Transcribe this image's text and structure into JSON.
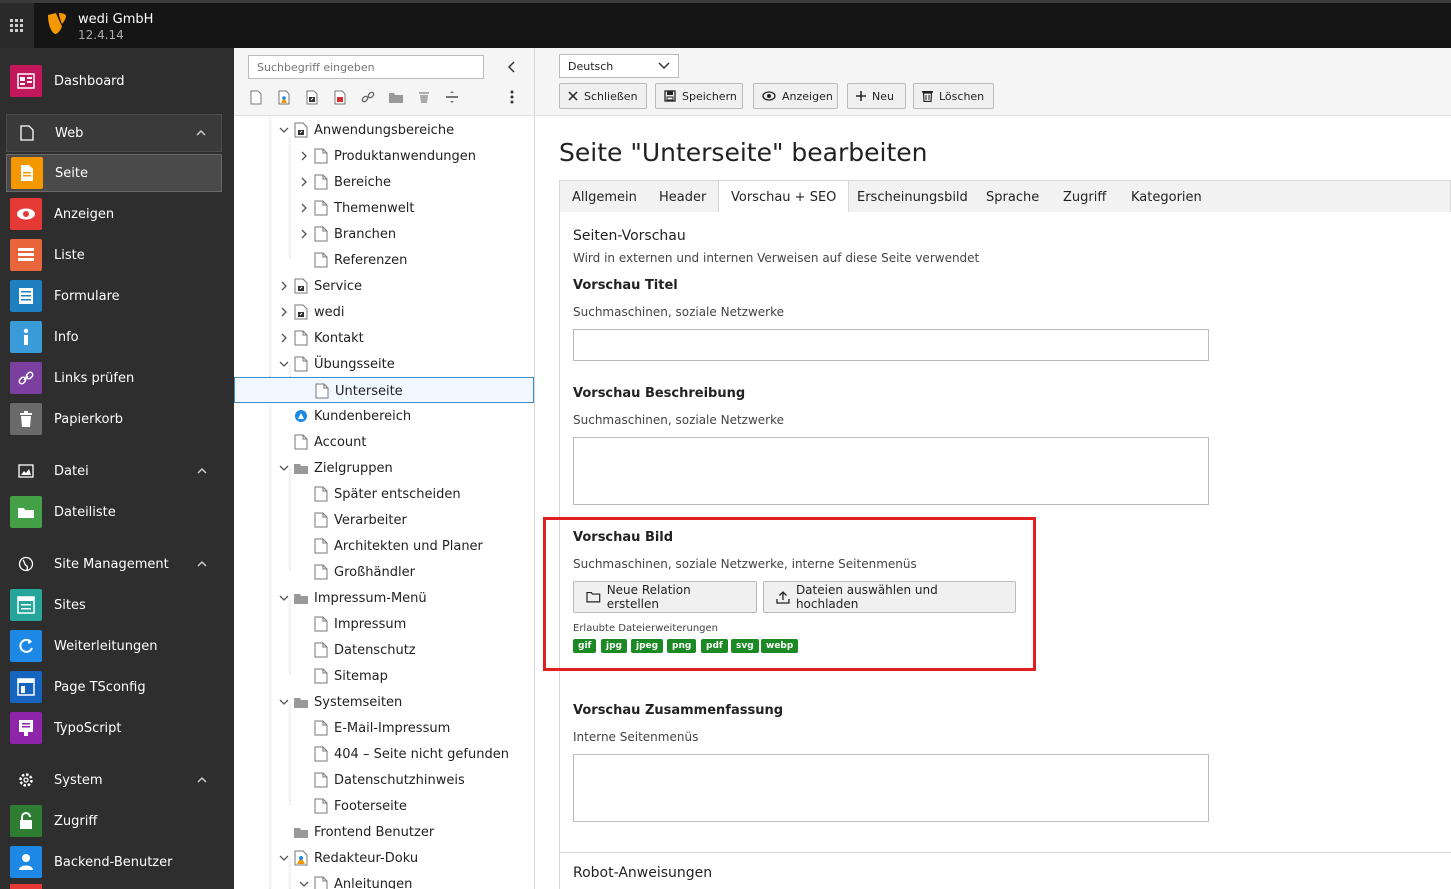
{
  "topbar": {
    "site_name": "wedi GmbH",
    "version": "12.4.14"
  },
  "modulemenu": {
    "dashboard": "Dashboard",
    "web_group": "Web",
    "seite": "Seite",
    "anzeigen": "Anzeigen",
    "liste": "Liste",
    "formulare": "Formulare",
    "info": "Info",
    "links_pruefen": "Links prüfen",
    "papierkorb": "Papierkorb",
    "datei_group": "Datei",
    "dateiliste": "Dateiliste",
    "site_management_group": "Site Management",
    "sites": "Sites",
    "weiterleitungen": "Weiterleitungen",
    "page_tsconfig": "Page TSconfig",
    "typoscript": "TypoScript",
    "system_group": "System",
    "zugriff": "Zugriff",
    "backend_benutzer": "Backend-Benutzer"
  },
  "pagetree": {
    "search_placeholder": "Suchbegriff eingeben",
    "nodes": [
      "Anwendungsbereiche",
      "Produktanwendungen",
      "Bereiche",
      "Themenwelt",
      "Branchen",
      "Referenzen",
      "Service",
      "wedi",
      "Kontakt",
      "Übungsseite",
      "Unterseite",
      "Kundenbereich",
      "Account",
      "Zielgruppen",
      "Später entscheiden",
      "Verarbeiter",
      "Architekten und Planer",
      "Großhändler",
      "Impressum-Menü",
      "Impressum",
      "Datenschutz",
      "Sitemap",
      "Systemseiten",
      "E-Mail-Impressum",
      "404 – Seite nicht gefunden",
      "Datenschutzhinweis",
      "Footerseite",
      "Frontend Benutzer",
      "Redakteur-Doku",
      "Anleitungen"
    ]
  },
  "docheader": {
    "language": "Deutsch",
    "buttons": {
      "close": "Schließen",
      "save": "Speichern",
      "view": "Anzeigen",
      "new": "Neu",
      "delete": "Löschen"
    }
  },
  "editor": {
    "title": "Seite \"Unterseite\" bearbeiten",
    "tabs": [
      "Allgemein",
      "Header",
      "Vorschau + SEO",
      "Erscheinungsbild",
      "Sprache",
      "Zugriff",
      "Kategorien"
    ],
    "active_tab": "Vorschau + SEO",
    "section_title": "Seiten-Vorschau",
    "section_help": "Wird in externen und internen Verweisen auf diese Seite verwendet",
    "fields": {
      "og_title_label": "Vorschau Titel",
      "og_title_desc": "Suchmaschinen, soziale Netzwerke",
      "og_title_value": "",
      "description_label": "Vorschau Beschreibung",
      "description_desc": "Suchmaschinen, soziale Netzwerke",
      "description_value": "",
      "image_label": "Vorschau Bild",
      "image_desc": "Suchmaschinen, soziale Netzwerke, interne Seitenmenüs",
      "new_relation_btn": "Neue Relation erstellen",
      "upload_btn": "Dateien auswählen und hochladen",
      "allowed_ext_label": "Erlaubte Dateierweiterungen",
      "allowed_ext": [
        "gif",
        "jpg",
        "jpeg",
        "png",
        "pdf",
        "svg",
        "webp"
      ],
      "abstract_label": "Vorschau Zusammenfassung",
      "abstract_desc": "Interne Seitenmenüs",
      "abstract_value": ""
    },
    "robots_section_title": "Robot-Anweisungen"
  },
  "colors": {
    "topbar_bg": "#151515",
    "modulemenu_bg": "#2e2e2e",
    "typo3_orange": "#f49700",
    "badge_green": "#1c8a24",
    "highlight_red": "#e02020",
    "selected_blue": "#3c8ed1"
  },
  "icons": {
    "apps": "grid-icon",
    "logo": "typo3-logo",
    "collapse": "chevron-left-icon"
  }
}
